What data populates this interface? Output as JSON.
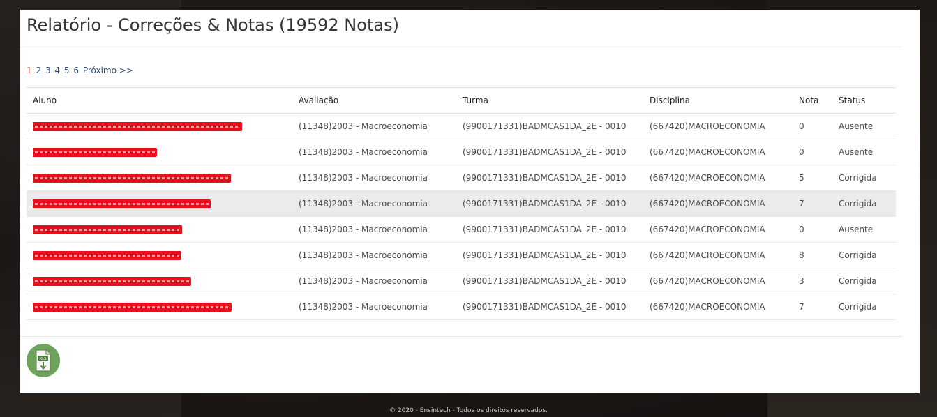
{
  "page": {
    "title": "Relatório - Correções & Notas (19592 Notas)"
  },
  "pager": {
    "pages": [
      "1",
      "2",
      "3",
      "4",
      "5",
      "6"
    ],
    "current": "1",
    "next_label": "Próximo >>"
  },
  "table": {
    "headers": [
      "Aluno",
      "Avaliação",
      "Turma",
      "Disciplina",
      "Nota",
      "Status"
    ],
    "rows": [
      {
        "aluno_redacted": true,
        "avaliacao": "(11348)2003 - Macroeconomia",
        "turma": "(9900171331)BADMCAS1DA_2E - 0010",
        "disciplina": "(667420)MACROECONOMIA",
        "nota": "0",
        "status": "Ausente"
      },
      {
        "aluno_redacted": true,
        "avaliacao": "(11348)2003 - Macroeconomia",
        "turma": "(9900171331)BADMCAS1DA_2E - 0010",
        "disciplina": "(667420)MACROECONOMIA",
        "nota": "0",
        "status": "Ausente"
      },
      {
        "aluno_redacted": true,
        "avaliacao": "(11348)2003 - Macroeconomia",
        "turma": "(9900171331)BADMCAS1DA_2E - 0010",
        "disciplina": "(667420)MACROECONOMIA",
        "nota": "5",
        "status": "Corrigida"
      },
      {
        "aluno_redacted": true,
        "avaliacao": "(11348)2003 - Macroeconomia",
        "turma": "(9900171331)BADMCAS1DA_2E - 0010",
        "disciplina": "(667420)MACROECONOMIA",
        "nota": "7",
        "status": "Corrigida"
      },
      {
        "aluno_redacted": true,
        "avaliacao": "(11348)2003 - Macroeconomia",
        "turma": "(9900171331)BADMCAS1DA_2E - 0010",
        "disciplina": "(667420)MACROECONOMIA",
        "nota": "0",
        "status": "Ausente"
      },
      {
        "aluno_redacted": true,
        "avaliacao": "(11348)2003 - Macroeconomia",
        "turma": "(9900171331)BADMCAS1DA_2E - 0010",
        "disciplina": "(667420)MACROECONOMIA",
        "nota": "8",
        "status": "Corrigida"
      },
      {
        "aluno_redacted": true,
        "avaliacao": "(11348)2003 - Macroeconomia",
        "turma": "(9900171331)BADMCAS1DA_2E - 0010",
        "disciplina": "(667420)MACROECONOMIA",
        "nota": "3",
        "status": "Corrigida"
      },
      {
        "aluno_redacted": true,
        "avaliacao": "(11348)2003 - Macroeconomia",
        "turma": "(9900171331)BADMCAS1DA_2E - 0010",
        "disciplina": "(667420)MACROECONOMIA",
        "nota": "7",
        "status": "Corrigida"
      }
    ]
  },
  "export": {
    "icon": "xls-file-download-icon",
    "icon_label": "XLS"
  },
  "colors": {
    "accent_current_page": "#e07050",
    "link": "#2c4a7a",
    "redaction": "#e8101c",
    "export_button": "#6fa35d"
  },
  "footer": {
    "text": "© 2020 - Ensintech - Todos os direitos reservados."
  }
}
